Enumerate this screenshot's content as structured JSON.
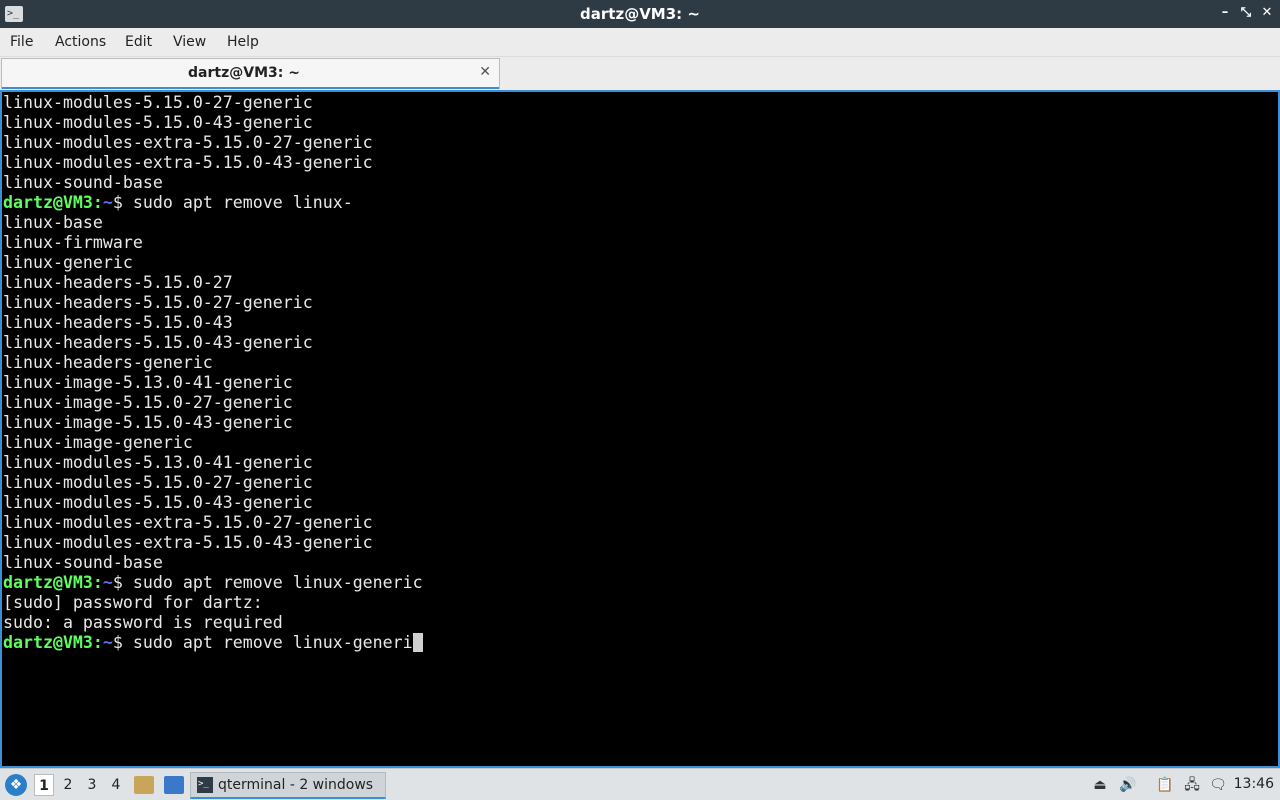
{
  "window": {
    "title": "dartz@VM3: ~",
    "minimize_label": "–",
    "maximize_label": "⤡",
    "close_label": "✕"
  },
  "menu": {
    "items": [
      "File",
      "Actions",
      "Edit",
      "View",
      "Help"
    ]
  },
  "tab": {
    "label": "dartz@VM3: ~",
    "close_label": "✕"
  },
  "terminal": {
    "prompt_user": "dartz@VM3",
    "prompt_path": "~",
    "prompt_suffix": "$ ",
    "lines": [
      {
        "type": "output",
        "text": "linux-modules-5.15.0-27-generic"
      },
      {
        "type": "output",
        "text": "linux-modules-5.15.0-43-generic"
      },
      {
        "type": "output",
        "text": "linux-modules-extra-5.15.0-27-generic"
      },
      {
        "type": "output",
        "text": "linux-modules-extra-5.15.0-43-generic"
      },
      {
        "type": "output",
        "text": "linux-sound-base"
      },
      {
        "type": "prompt",
        "text": "sudo apt remove linux-"
      },
      {
        "type": "output",
        "text": "linux-base"
      },
      {
        "type": "output",
        "text": "linux-firmware"
      },
      {
        "type": "output",
        "text": "linux-generic"
      },
      {
        "type": "output",
        "text": "linux-headers-5.15.0-27"
      },
      {
        "type": "output",
        "text": "linux-headers-5.15.0-27-generic"
      },
      {
        "type": "output",
        "text": "linux-headers-5.15.0-43"
      },
      {
        "type": "output",
        "text": "linux-headers-5.15.0-43-generic"
      },
      {
        "type": "output",
        "text": "linux-headers-generic"
      },
      {
        "type": "output",
        "text": "linux-image-5.13.0-41-generic"
      },
      {
        "type": "output",
        "text": "linux-image-5.15.0-27-generic"
      },
      {
        "type": "output",
        "text": "linux-image-5.15.0-43-generic"
      },
      {
        "type": "output",
        "text": "linux-image-generic"
      },
      {
        "type": "output",
        "text": "linux-modules-5.13.0-41-generic"
      },
      {
        "type": "output",
        "text": "linux-modules-5.15.0-27-generic"
      },
      {
        "type": "output",
        "text": "linux-modules-5.15.0-43-generic"
      },
      {
        "type": "output",
        "text": "linux-modules-extra-5.15.0-27-generic"
      },
      {
        "type": "output",
        "text": "linux-modules-extra-5.15.0-43-generic"
      },
      {
        "type": "output",
        "text": "linux-sound-base"
      },
      {
        "type": "prompt",
        "text": "sudo apt remove linux-generic"
      },
      {
        "type": "output",
        "text": "[sudo] password for dartz:"
      },
      {
        "type": "output",
        "text": "sudo: a password is required"
      },
      {
        "type": "prompt",
        "text": "sudo apt remove linux-generi",
        "cursor": true
      }
    ]
  },
  "taskbar": {
    "desktops": [
      "1",
      "2",
      "3",
      "4"
    ],
    "active_desktop": "1",
    "task_label": "qterminal - 2 windows",
    "clock": "13:46",
    "start_icon": "lxqt-menu-icon",
    "tray_icons": [
      "eject-icon",
      "volume-icon",
      "clipboard-icon",
      "network-icon",
      "updates-icon"
    ]
  },
  "colors": {
    "titlebar_bg": "#2e3a44",
    "accent": "#3c8fd6",
    "terminal_bg": "#000000",
    "prompt_user": "#5fff5f",
    "prompt_path": "#5c6cff"
  }
}
